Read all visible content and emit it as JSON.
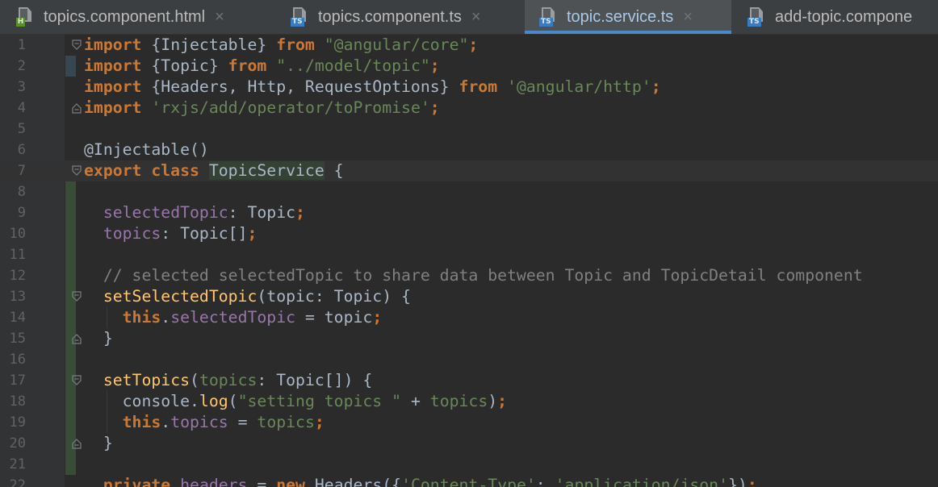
{
  "tabs": [
    {
      "label": "topics.component.html",
      "icon": "html-file-icon",
      "badge": "H",
      "active": false
    },
    {
      "label": "topics.component.ts",
      "icon": "ts-file-icon",
      "badge": "TS",
      "active": false
    },
    {
      "label": "topic.service.ts",
      "icon": "ts-file-icon",
      "badge": "TS",
      "active": true
    },
    {
      "label": "add-topic.compone",
      "icon": "ts-file-icon",
      "badge": "TS",
      "active": false
    }
  ],
  "close_glyph": "×",
  "colors": {
    "keyword": "#cc7832",
    "string": "#6a8759",
    "field": "#9876aa",
    "function": "#ffc66d",
    "comment": "#808080",
    "text": "#a9b7c6",
    "active_tab_underline": "#4a88c7"
  },
  "code_lines": [
    {
      "n": "1",
      "tokens": [
        [
          "kw",
          "import"
        ],
        [
          "plain",
          " {Injectable} "
        ],
        [
          "kw",
          "from"
        ],
        [
          "plain",
          " "
        ],
        [
          "str",
          "\"@angular/core\""
        ],
        [
          "kw",
          ";"
        ]
      ]
    },
    {
      "n": "2",
      "tokens": [
        [
          "kw",
          "import"
        ],
        [
          "plain",
          " {Topic} "
        ],
        [
          "kw",
          "from"
        ],
        [
          "plain",
          " "
        ],
        [
          "str",
          "\"../model/topic\""
        ],
        [
          "kw",
          ";"
        ]
      ]
    },
    {
      "n": "3",
      "tokens": [
        [
          "kw",
          "import"
        ],
        [
          "plain",
          " {Headers, Http, RequestOptions} "
        ],
        [
          "kw",
          "from"
        ],
        [
          "plain",
          " "
        ],
        [
          "str",
          "'@angular/http'"
        ],
        [
          "kw",
          ";"
        ]
      ]
    },
    {
      "n": "4",
      "tokens": [
        [
          "kw",
          "import"
        ],
        [
          "plain",
          " "
        ],
        [
          "str",
          "'rxjs/add/operator/toPromise'"
        ],
        [
          "kw",
          ";"
        ]
      ]
    },
    {
      "n": "5",
      "tokens": []
    },
    {
      "n": "6",
      "tokens": [
        [
          "plain",
          "@Injectable()"
        ]
      ]
    },
    {
      "n": "7",
      "tokens": [
        [
          "kw",
          "export class"
        ],
        [
          "plain",
          " "
        ],
        [
          "hl",
          "TopicService"
        ],
        [
          "plain",
          " {"
        ]
      ]
    },
    {
      "n": "8",
      "tokens": []
    },
    {
      "n": "9",
      "tokens": [
        [
          "plain",
          "  "
        ],
        [
          "fld",
          "selectedTopic"
        ],
        [
          "plain",
          ": Topic"
        ],
        [
          "kw",
          ";"
        ]
      ]
    },
    {
      "n": "10",
      "tokens": [
        [
          "plain",
          "  "
        ],
        [
          "fld",
          "topics"
        ],
        [
          "plain",
          ": Topic[]"
        ],
        [
          "kw",
          ";"
        ]
      ]
    },
    {
      "n": "11",
      "tokens": []
    },
    {
      "n": "12",
      "tokens": [
        [
          "plain",
          "  "
        ],
        [
          "cmt",
          "// selected selectedTopic to share data between Topic and TopicDetail component"
        ]
      ]
    },
    {
      "n": "13",
      "tokens": [
        [
          "plain",
          "  "
        ],
        [
          "fn",
          "setSelectedTopic"
        ],
        [
          "plain",
          "(topic: Topic) {"
        ]
      ]
    },
    {
      "n": "14",
      "tokens": [
        [
          "plain",
          "    "
        ],
        [
          "kw",
          "this"
        ],
        [
          "plain",
          "."
        ],
        [
          "fld",
          "selectedTopic"
        ],
        [
          "plain",
          " = topic"
        ],
        [
          "kw",
          ";"
        ]
      ]
    },
    {
      "n": "15",
      "tokens": [
        [
          "plain",
          "  }"
        ]
      ]
    },
    {
      "n": "16",
      "tokens": []
    },
    {
      "n": "17",
      "tokens": [
        [
          "plain",
          "  "
        ],
        [
          "fn",
          "setTopics"
        ],
        [
          "plain",
          "("
        ],
        [
          "str",
          "topics"
        ],
        [
          "plain",
          ": Topic[]) {"
        ]
      ]
    },
    {
      "n": "18",
      "tokens": [
        [
          "plain",
          "    console."
        ],
        [
          "fn",
          "log"
        ],
        [
          "plain",
          "("
        ],
        [
          "str",
          "\"setting topics \""
        ],
        [
          "plain",
          " + "
        ],
        [
          "str",
          "topics"
        ],
        [
          "plain",
          ")"
        ],
        [
          "kw",
          ";"
        ]
      ]
    },
    {
      "n": "19",
      "tokens": [
        [
          "plain",
          "    "
        ],
        [
          "kw",
          "this"
        ],
        [
          "plain",
          "."
        ],
        [
          "fld",
          "topics"
        ],
        [
          "plain",
          " = "
        ],
        [
          "str",
          "topics"
        ],
        [
          "kw",
          ";"
        ]
      ]
    },
    {
      "n": "20",
      "tokens": [
        [
          "plain",
          "  }"
        ]
      ]
    },
    {
      "n": "21",
      "tokens": []
    },
    {
      "n": "22",
      "tokens": [
        [
          "plain",
          "  "
        ],
        [
          "kw",
          "private"
        ],
        [
          "plain",
          " "
        ],
        [
          "fld",
          "headers"
        ],
        [
          "plain",
          " = "
        ],
        [
          "kw",
          "new"
        ],
        [
          "plain",
          " Headers({"
        ],
        [
          "str",
          "'Content-Type'"
        ],
        [
          "plain",
          ": "
        ],
        [
          "str",
          "'application/json'"
        ],
        [
          "plain",
          "})"
        ],
        [
          "kw",
          ";"
        ]
      ]
    }
  ]
}
